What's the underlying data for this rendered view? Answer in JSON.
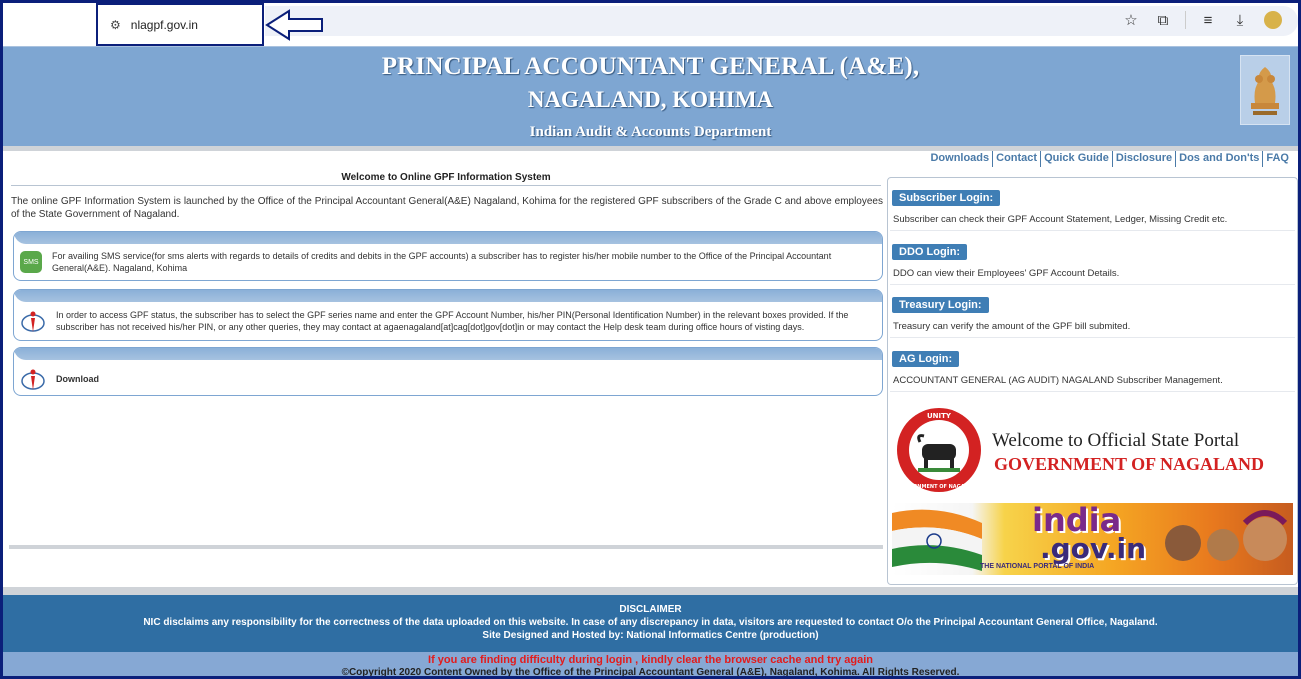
{
  "browser": {
    "url": "nlagpf.gov.in",
    "icons": [
      "tune-icon",
      "star-icon",
      "extensions-icon",
      "reading-list-icon",
      "download-icon",
      "profile-icon"
    ]
  },
  "header": {
    "line1": "PRINCIPAL ACCOUNTANT GENERAL (A&E),",
    "line2": "NAGALAND, KOHIMA",
    "line3": "Indian Audit & Accounts Department"
  },
  "nav": {
    "items": [
      "Downloads",
      "Contact",
      "Quick Guide",
      "Disclosure",
      "Dos and Don'ts",
      "FAQ"
    ]
  },
  "main": {
    "title": "Welcome to Online GPF Information System",
    "intro": "The online GPF Information System is launched by the Office of the Principal Accountant General(A&E) Nagaland, Kohima for the registered GPF subscribers of the Grade C and above employees of the State Government of Nagaland.",
    "sms_icon_text": "SMS",
    "sms_text": "For availing SMS service(for sms alerts with regards to details of credits and debits in the GPF accounts) a subscriber has to register his/her mobile number to the Office of the Principal Accountant General(A&E). Nagaland, Kohima",
    "access_text": "In order to access GPF status, the subscriber has to select the GPF series name and enter the GPF Account Number, his/her PIN(Personal Identification Number) in the relevant boxes provided. If the subscriber has not received his/her PIN, or any other queries, they may contact at agaenagaland[at]cag[dot]gov[dot]in or may contact the Help desk team during office hours of visting days.",
    "download_label": "Download"
  },
  "logins": [
    {
      "label": "Subscriber Login:",
      "desc": "Subscriber can check their GPF Account Statement, Ledger, Missing Credit etc."
    },
    {
      "label": "DDO Login:",
      "desc": "DDO can view their Employees' GPF Account Details."
    },
    {
      "label": "Treasury Login:",
      "desc": "Treasury can verify the amount of the GPF bill submited."
    },
    {
      "label": "AG Login:",
      "desc": "ACCOUNTANT GENERAL (AG AUDIT) NAGALAND Subscriber Management."
    }
  ],
  "state_portal": {
    "seal_top": "UNITY",
    "seal_bottom": "GOVERNMENT OF NAGALAND",
    "line1": "Welcome to Official State Portal",
    "line2": "GOVERNMENT OF NAGALAND"
  },
  "india_banner": {
    "word1": "india",
    "word2": ".gov.in",
    "tagline": "THE NATIONAL PORTAL OF INDIA"
  },
  "footer": {
    "heading": "DISCLAIMER",
    "disclaimer": "NIC disclaims any responsibility for the correctness of the data uploaded on this website. In case of any discrepancy in data, visitors are requested to contact O/o the Principal Accountant General Office, Nagaland.",
    "hosted": "Site Designed and Hosted by: National Informatics Centre (production)",
    "warning": "If you are finding difficulty during login , kindly clear the browser cache and try again",
    "copyright": "©Copyright 2020 Content Owned by the Office of the Principal Accountant General (A&E), Nagaland, Kohima. All Rights Reserved."
  },
  "colors": {
    "header_bg": "#7ea6d2",
    "footer_bg": "#2f6ea3",
    "login_btn": "#3f7eb5",
    "warning": "#e31b1b",
    "annotation_border": "#0b1f7a"
  }
}
